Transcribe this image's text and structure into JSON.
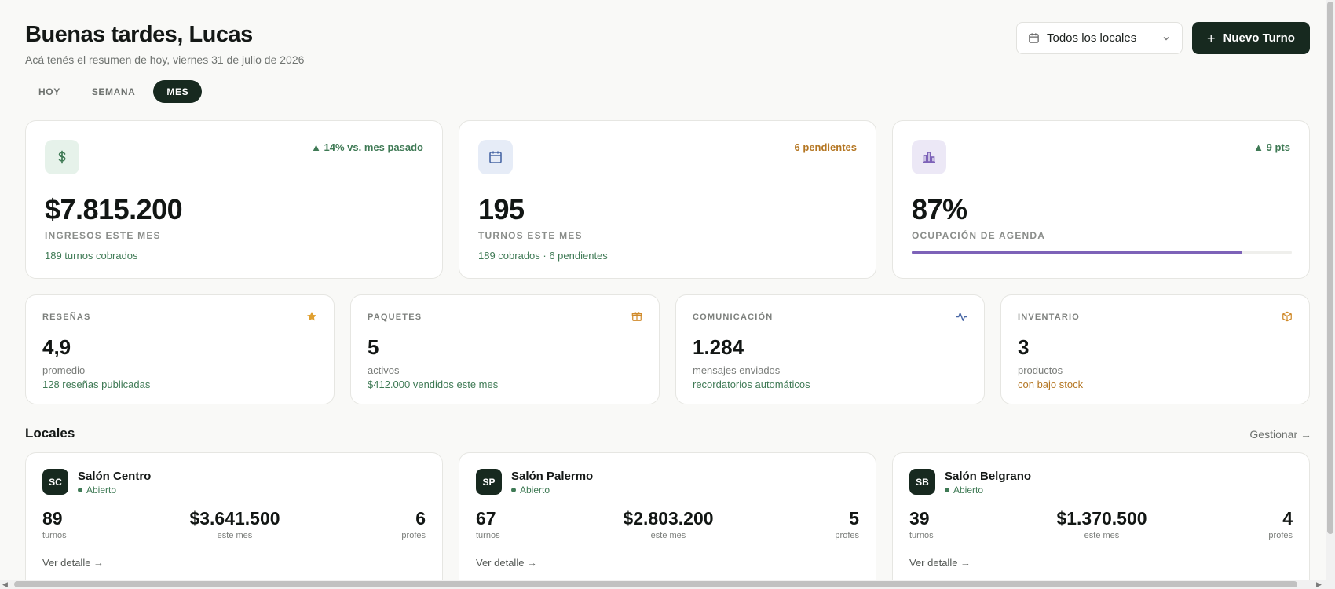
{
  "header": {
    "greeting": "Buenas tardes, Lucas",
    "subtitle": "Acá tenés el resumen de hoy, viernes 31 de julio de 2026",
    "location_select": "Todos los locales",
    "new_button": "Nuevo Turno"
  },
  "tabs": [
    "HOY",
    "SEMANA",
    "MES"
  ],
  "active_tab": "MES",
  "kpis": [
    {
      "icon": "dollar-icon",
      "delta": "▲ 14% vs. mes pasado",
      "value": "$7.815.200",
      "label": "INGRESOS ESTE MES",
      "sub": "189 turnos cobrados",
      "accent": "#3f7a55",
      "icon_bg": "#e6f2ea"
    },
    {
      "icon": "calendar-icon",
      "delta": "6 pendientes",
      "value": "195",
      "label": "TURNOS ESTE MES",
      "sub": "189 cobrados · 6 pendientes",
      "accent": "#b47622",
      "icon_bg": "#e6ecf7"
    },
    {
      "icon": "bar-chart-icon",
      "delta": "▲ 9 pts",
      "value": "87%",
      "label": "OCUPACIÓN DE AGENDA",
      "progress": 0.87,
      "accent": "#3f7a55",
      "icon_bg": "#ece8f6"
    }
  ],
  "minis": [
    {
      "label": "RESEÑAS",
      "icon": "star-icon",
      "value": "4,9",
      "unit": "promedio",
      "sub": "128 reseñas publicadas"
    },
    {
      "label": "PAQUETES",
      "icon": "gift-icon",
      "value": "5",
      "unit": "activos",
      "sub": "$412.000 vendidos este mes"
    },
    {
      "label": "COMUNICACIÓN",
      "icon": "activity-icon",
      "value": "1.284",
      "unit": "mensajes enviados",
      "sub": "recordatorios automáticos"
    },
    {
      "label": "INVENTARIO",
      "icon": "box-icon",
      "value": "3",
      "unit": "productos",
      "sub": "con bajo stock"
    }
  ],
  "locales": {
    "title": "Locales",
    "manage": "Gestionar →",
    "items": [
      {
        "initials": "SC",
        "name": "Salón Centro",
        "status": "Abierto",
        "turnos": "89",
        "turnos_label": "turnos",
        "revenue": "$3.641.500",
        "revenue_label": "este mes",
        "profes": "6",
        "profes_label": "profes",
        "detail": "Ver detalle →"
      },
      {
        "initials": "SP",
        "name": "Salón Palermo",
        "status": "Abierto",
        "turnos": "67",
        "turnos_label": "turnos",
        "revenue": "$2.803.200",
        "revenue_label": "este mes",
        "profes": "5",
        "profes_label": "profes",
        "detail": "Ver detalle →"
      },
      {
        "initials": "SB",
        "name": "Salón Belgrano",
        "status": "Abierto",
        "turnos": "39",
        "turnos_label": "turnos",
        "revenue": "$1.370.500",
        "revenue_label": "este mes",
        "profes": "4",
        "profes_label": "profes",
        "detail": "Ver detalle →"
      }
    ]
  },
  "colors": {
    "brand": "#17291f",
    "positive": "#3f7a55",
    "warning": "#b47622",
    "purple": "#7d62b8"
  }
}
